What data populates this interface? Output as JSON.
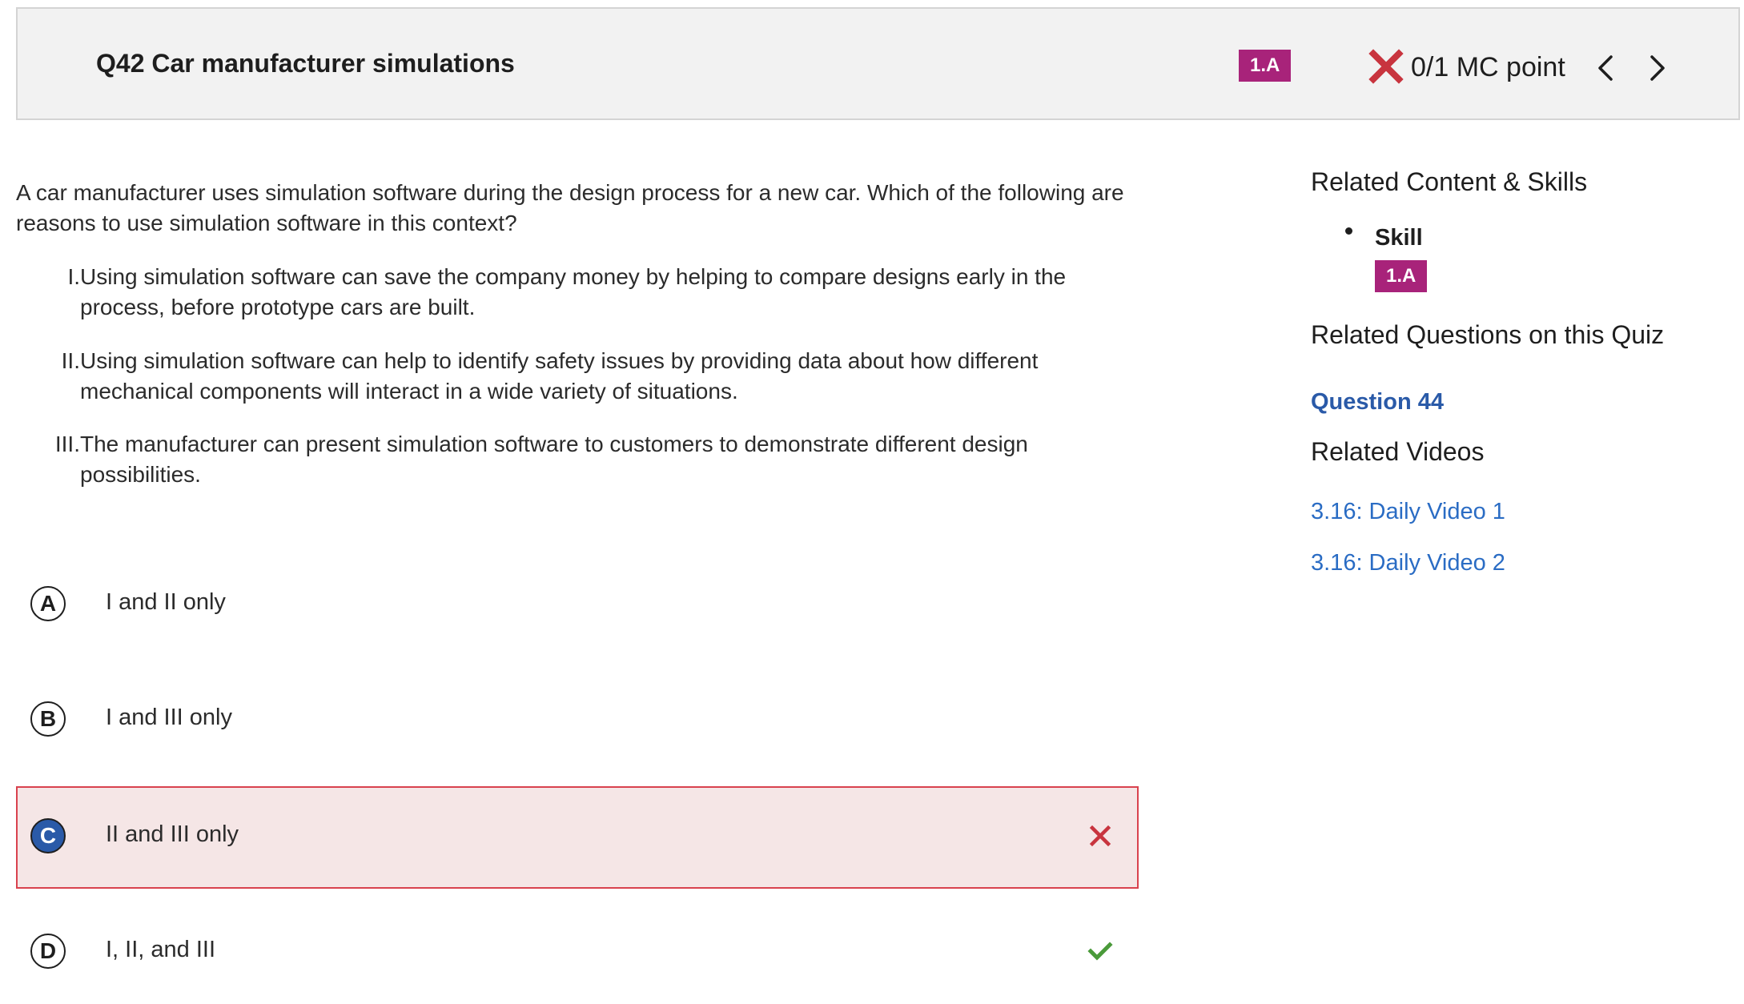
{
  "header": {
    "title": "Q42 Car manufacturer simulations",
    "skill_badge": "1.A",
    "score": "0/1 MC point",
    "score_icon": "incorrect-x-icon",
    "prev_icon": "chevron-left-icon",
    "next_icon": "chevron-right-icon"
  },
  "question": {
    "stem": "A car manufacturer uses simulation software during the design process for a new car. Which of the following are reasons to use simulation software in this context?",
    "statements": [
      {
        "num": "I.",
        "text": "Using simulation software can save the company money by helping to compare designs early in the process, before prototype cars are built."
      },
      {
        "num": "II.",
        "text": "Using simulation software can help to identify safety issues by providing data about how different mechanical components will interact in a wide variety of situations."
      },
      {
        "num": "III.",
        "text": "The manufacturer can present simulation software to customers to demonstrate different design possibilities."
      }
    ]
  },
  "choices": [
    {
      "letter": "A",
      "text": "I and II only",
      "selected": false,
      "mark": ""
    },
    {
      "letter": "B",
      "text": "I and III only",
      "selected": false,
      "mark": ""
    },
    {
      "letter": "C",
      "text": "II and III only",
      "selected": true,
      "mark": "incorrect-x-icon"
    },
    {
      "letter": "D",
      "text": "I, II, and III",
      "selected": false,
      "mark": "correct-check-icon"
    }
  ],
  "sidebar": {
    "related_content_heading": "Related Content & Skills",
    "skill_label": "Skill",
    "skill_badge": "1.A",
    "related_questions_heading": "Related Questions on this Quiz",
    "related_question_link": "Question 44",
    "related_videos_heading": "Related Videos",
    "videos": [
      "3.16: Daily Video 1",
      "3.16: Daily Video 2"
    ]
  },
  "colors": {
    "badge": "#a8237a",
    "incorrect": "#c8343e",
    "correct": "#4a9a3a",
    "link": "#2a6cc4",
    "selected_fill": "#f5e6e6",
    "selected_border": "#d9424e",
    "selected_letter": "#2a5aa8"
  }
}
